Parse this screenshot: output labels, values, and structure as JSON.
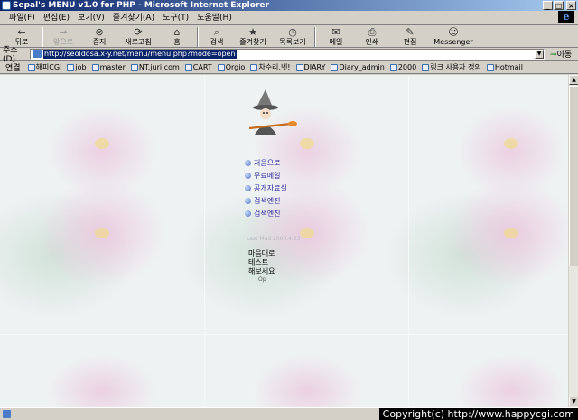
{
  "window": {
    "title": "Sepal's MENU v1.0 for PHP - Microsoft Internet Explorer",
    "buttons": [
      "_",
      "□",
      "×"
    ]
  },
  "menubar": {
    "items": [
      "파일(F)",
      "편집(E)",
      "보기(V)",
      "즐겨찾기(A)",
      "도구(T)",
      "도움말(H)"
    ]
  },
  "toolbar": {
    "buttons": [
      {
        "label": "뒤로",
        "icon": "←"
      },
      {
        "label": "앞으로",
        "icon": "→"
      },
      {
        "label": "중지",
        "icon": "⊗"
      },
      {
        "label": "새로고침",
        "icon": "⟳"
      },
      {
        "label": "홈",
        "icon": "⌂"
      },
      {
        "label": "검색",
        "icon": "⌕"
      },
      {
        "label": "즐겨찾기",
        "icon": "★"
      },
      {
        "label": "목록보기",
        "icon": "◷"
      },
      {
        "label": "메일",
        "icon": "✉"
      },
      {
        "label": "인쇄",
        "icon": "⎙"
      },
      {
        "label": "편집",
        "icon": "✎"
      },
      {
        "label": "Messenger",
        "icon": "☺"
      }
    ]
  },
  "address": {
    "label": "주소(D)",
    "url": "http://seoldosa.x-y.net/menu/menu.php?mode=open",
    "go_label": "이동"
  },
  "links": {
    "label": "연결",
    "items": [
      "해피CGI",
      "job",
      "master",
      "NT.juri.com",
      "CART",
      "Orgio",
      "차수리,넷!",
      "DIARY",
      "Diary_admin",
      "2000",
      "링크 사용자 정의",
      "Hotmail"
    ]
  },
  "page": {
    "menu_items": [
      "처음으로",
      "무료메일",
      "공개자료실",
      "검색엔진",
      "검색엔진"
    ],
    "faded_caption": "Last Mad 2000.4.23",
    "side_text": [
      "마음대로",
      "테스트",
      "해보세요"
    ],
    "side_small": "Op"
  },
  "statusbar": {
    "copyright": "Copyright(c) http://www.happycgi.com"
  },
  "colors": {
    "titlebar_start": "#0a246a",
    "titlebar_end": "#a6caf0",
    "menu_link": "#2a2aa0"
  }
}
